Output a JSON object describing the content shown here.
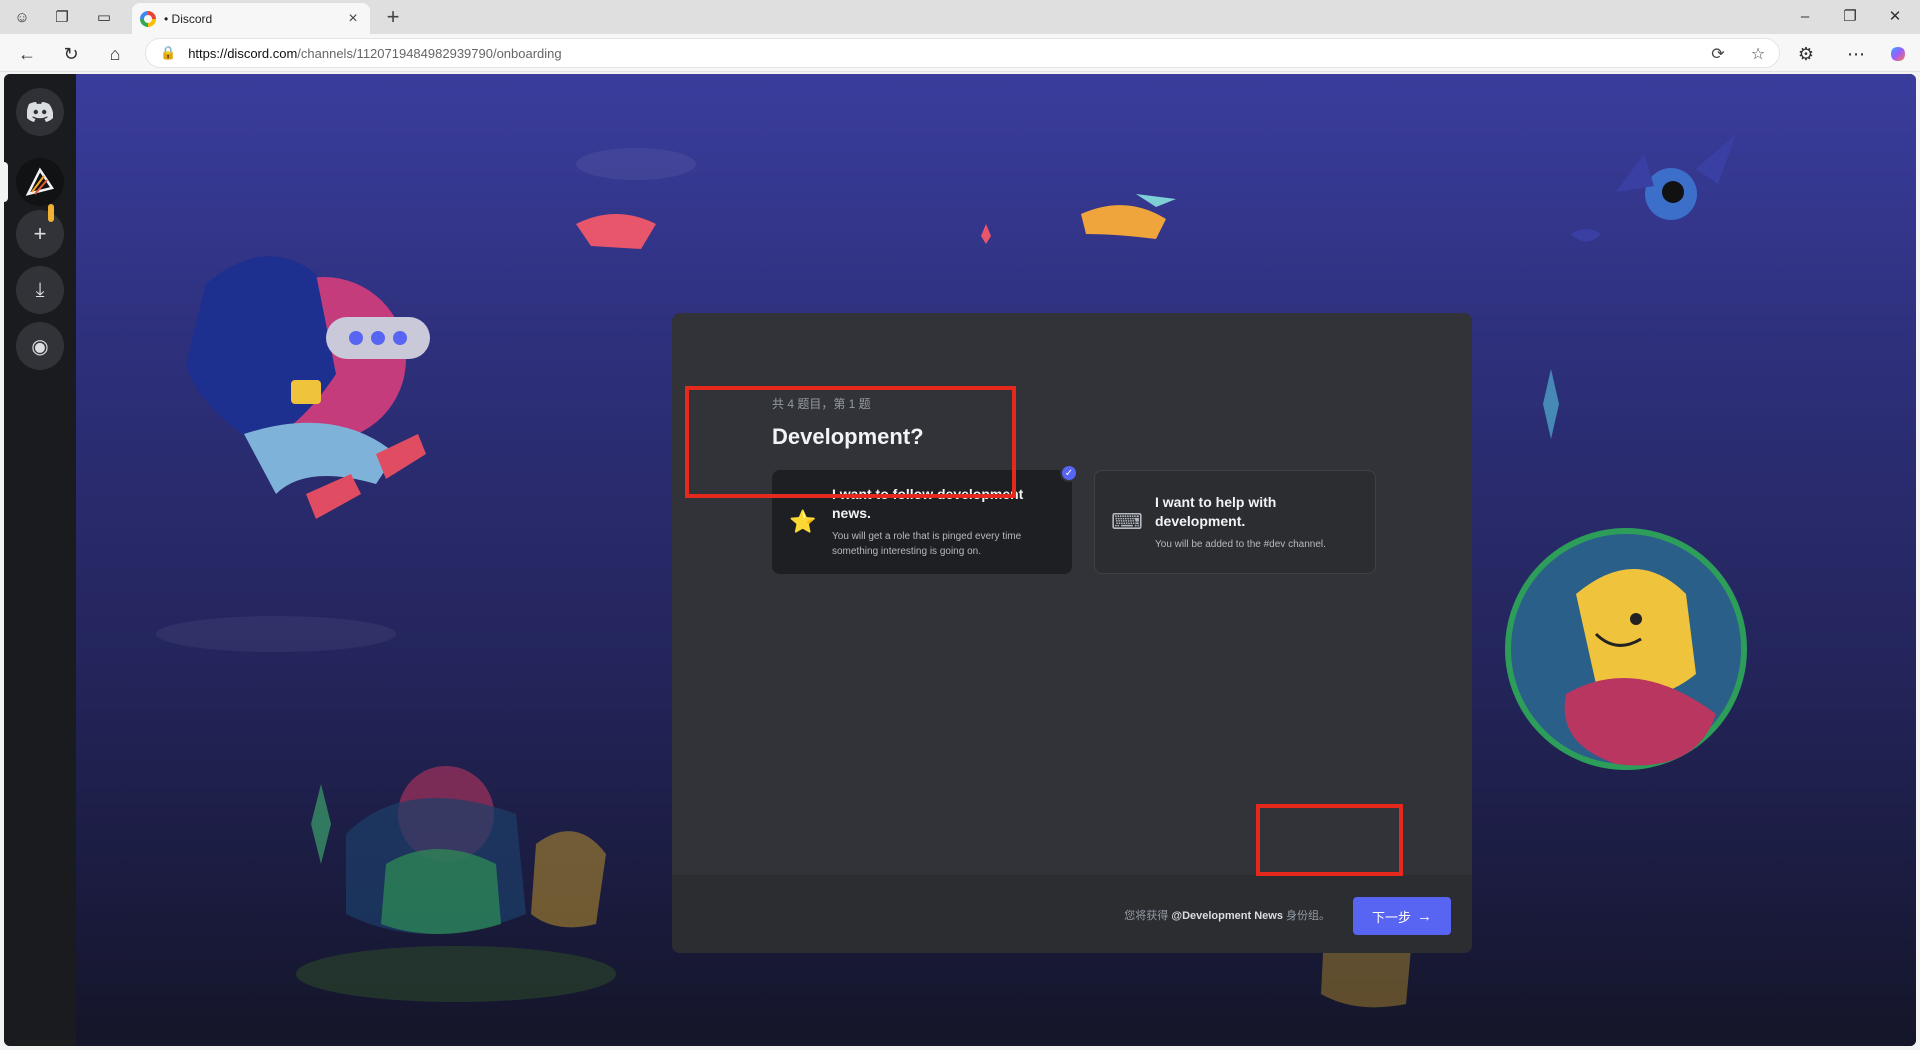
{
  "browser": {
    "tab_title": "• Discord",
    "url_host": "https://discord.com",
    "url_path": "/channels/1120719484982939790/onboarding",
    "icons": {
      "back": "arrow-left-icon",
      "refresh": "refresh-icon",
      "home": "home-icon",
      "lock": "lock-icon",
      "translate": "translate-icon",
      "favorite": "star-icon",
      "extensions": "puzzle-icon",
      "menu": "more-icon",
      "copilot": "copilot-icon"
    }
  },
  "sidebar": {
    "items": [
      {
        "name": "discord-home",
        "icon": "discord-icon"
      },
      {
        "name": "current-server",
        "icon": "server-logo-icon"
      },
      {
        "name": "add-server",
        "icon": "plus-icon"
      },
      {
        "name": "download-apps",
        "icon": "download-icon"
      },
      {
        "name": "discover",
        "icon": "compass-icon"
      }
    ]
  },
  "onboarding": {
    "step": "共 4 题目，第 1 题",
    "question": "Development?",
    "options": [
      {
        "emoji": "⭐",
        "title": "I want to follow development news.",
        "desc": "You will get a role that is pinged every time something interesting is going on.",
        "selected": true
      },
      {
        "emoji": "⌨",
        "title": "I want to help with development.",
        "desc": "You will be added to the #dev channel.",
        "selected": false
      }
    ],
    "footer_prefix": "您将获得",
    "footer_role": "@Development News",
    "footer_suffix": "身份组。",
    "next_label": "下一步",
    "next_arrow": "→"
  },
  "colors": {
    "brand": "#5865f2",
    "annotation": "#e52a1d"
  }
}
